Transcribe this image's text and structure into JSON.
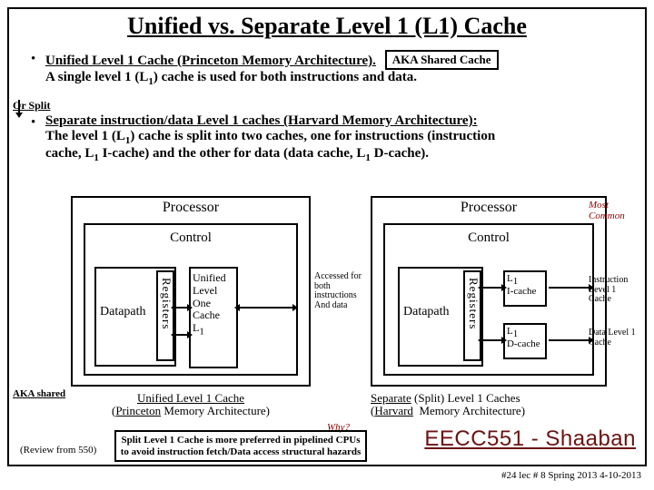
{
  "title_plain": "Unified vs. Separate Level 1 (L1) Cache",
  "bullet1_lead": "Unified Level 1 Cache  (Princeton Memory Architecture).",
  "aka_shared_box": "AKA Shared Cache",
  "bullet1_rest": "A single level 1 (L",
  "bullet1_rest2": ") cache is used for both instructions and data.",
  "or_split": "Or Split",
  "bullet2_lead": "Separate  instruction/data Level 1 caches (Harvard  Memory Architecture):",
  "bullet2_l2a": "The level 1 (L",
  "bullet2_l2b": ") cache is split into two caches, one for instructions (instruction",
  "bullet2_l3a": "cache, L",
  "bullet2_l3b": " I-cache) and the other for data (data cache, L",
  "bullet2_l3c": " D-cache).",
  "processor": "Processor",
  "control": "Control",
  "datapath": "Datapath",
  "registers": "Registers",
  "unified_cache_lines": "Unified\nLevel\nOne\nCache\nL",
  "most_common": "Most Common",
  "accessed_note": "Accessed for both instructions And data",
  "l1i": "L",
  "l1i2": "I-cache",
  "l1d": "L",
  "l1d2": "D-cache",
  "instr_note": "Instruction Level 1 Cache",
  "data_note": "Data Level 1 Cache",
  "aka_shared": "AKA shared",
  "cap_left_l1": "Unified Level 1 Cache",
  "cap_left_l2": "(Princeton Memory Architecture)",
  "cap_right_l1": "Separate (Split) Level 1 Caches",
  "cap_right_l2": "(Harvard  Memory Architecture)",
  "why": "Why?",
  "review": "(Review from 550)",
  "split_note": "Split Level 1 Cache is more preferred in pipelined CPUs to avoid instruction fetch/Data access structural hazards",
  "course": "EECC551 - Shaaban",
  "footer": "#24  lec # 8   Spring 2013  4-10-2013",
  "sub1": "1"
}
